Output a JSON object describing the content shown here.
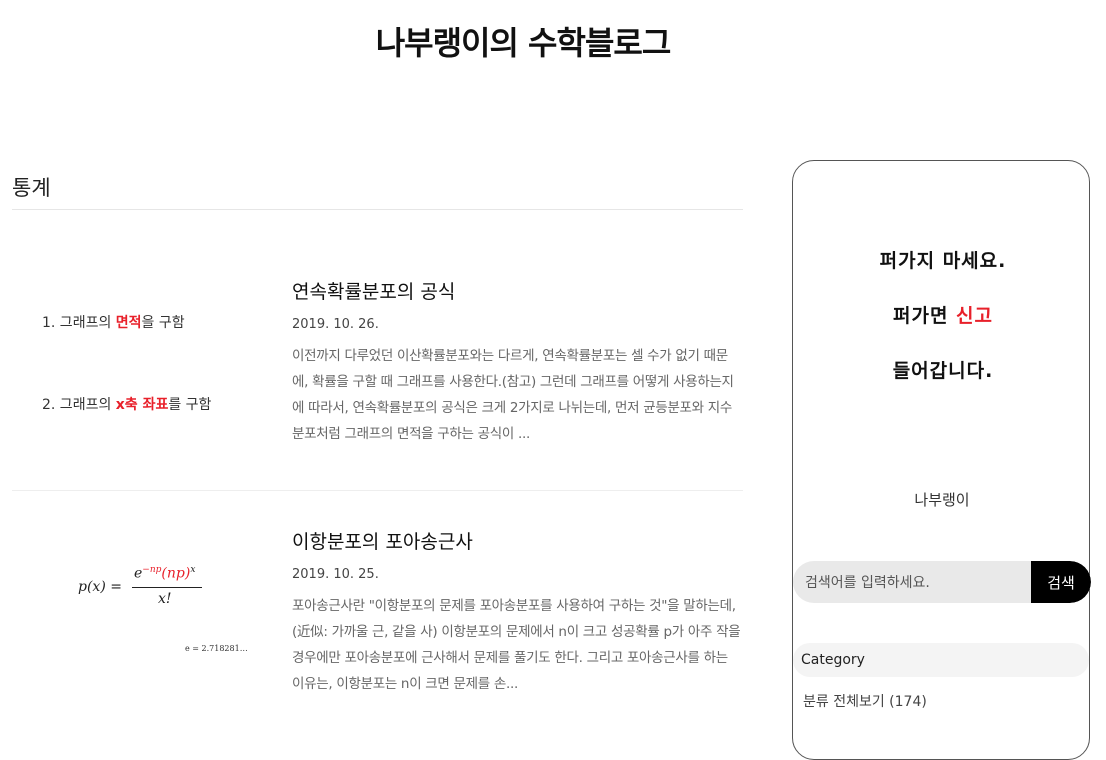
{
  "site": {
    "title": "나부랭이의 수학블로그"
  },
  "category": {
    "title": "통계"
  },
  "posts": [
    {
      "title": "연속확률분포의 공식",
      "date": "2019. 10. 26.",
      "excerpt": "이전까지 다루었던 이산확률분포와는 다르게, 연속확률분포는 셀 수가 없기 때문에, 확률을 구할 때 그래프를 사용한다.(참고) 그런데 그래프를 어떻게 사용하는지에 따라서, 연속확률분포의 공식은 크게 2가지로 나뉘는데, 먼저 균등분포와 지수분포처럼 그래프의 면적을 구하는 공식이 ...",
      "thumb": {
        "line1_pre": "1. 그래프의 ",
        "line1_em": "면적",
        "line1_post": "을 구함",
        "line2_pre": "2. 그래프의 ",
        "line2_em": "x축 좌표",
        "line2_post": "를 구함"
      }
    },
    {
      "title": "이항분포의 포아송근사",
      "date": "2019. 10. 25.",
      "excerpt": "포아송근사란 \"이항분포의 문제를 포아송분포를 사용하여 구하는 것\"을 말하는데,(近似: 가까울 근, 같을 사) 이항분포의 문제에서 n이 크고 성공확률 p가 아주 작을 경우에만 포아송분포에 근사해서 문제를 풀기도 한다. 그리고 포아송근사를 하는 이유는, 이항분포는 n이 크면 문제를 손...",
      "thumb": {
        "lhs": "p(x) =",
        "num_base": "e",
        "num_exp": "−np",
        "num_paren": "(np)",
        "num_pow": "x",
        "den": "x!",
        "e_value": "e = 2.718281…"
      }
    }
  ],
  "sidebar": {
    "banner": [
      "퍼가지 마세요.",
      "퍼가면 신고",
      "들어갑니다."
    ],
    "banner_red": "신고",
    "owner": "나부랭이",
    "search_placeholder": "검색어를 입력하세요.",
    "search_button": "검색",
    "category_header": "Category",
    "category_all": "분류 전체보기 (174)"
  },
  "colors": {
    "accent_red": "#e8202a",
    "search_btn": "#000000"
  }
}
